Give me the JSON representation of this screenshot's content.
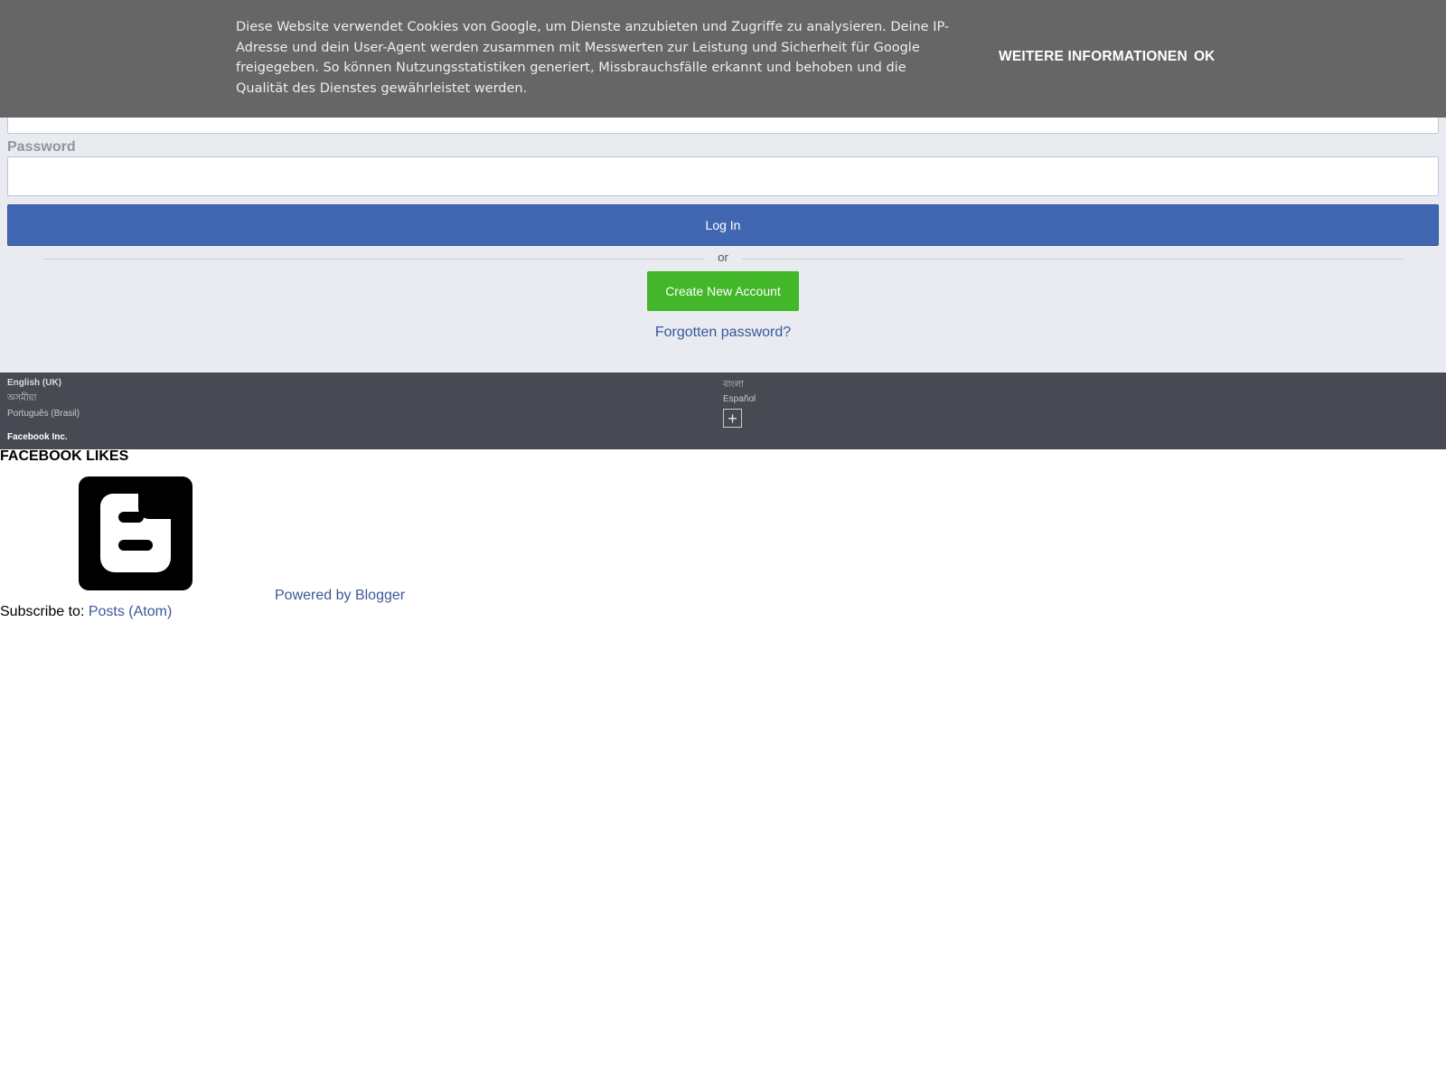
{
  "cookie_banner": {
    "message": "Diese Website verwendet Cookies von Google, um Dienste anzubieten und Zugriffe zu analysieren. Deine IP-Adresse und dein User-Agent werden zusammen mit Messwerten zur Leistung und Sicherheit für Google freigegeben. So können Nutzungsstatistiken generiert, Missbrauchsfälle erkannt und behoben und die Qualität des Dienstes gewährleistet werden.",
    "more_info_label": "WEITERE INFORMATIONEN",
    "ok_label": "OK",
    "background_color": "#666666"
  },
  "login": {
    "password_label": "Password",
    "login_button_label": "Log In",
    "or_label": "or",
    "create_account_label": "Create New Account",
    "forgot_password_label": "Forgotten password?",
    "primary_color": "#4267b2",
    "create_color": "#42b72a"
  },
  "language_footer": {
    "current_language": "English (UK)",
    "languages_left": [
      "অসমীয়া",
      "Português (Brasil)"
    ],
    "languages_right": [
      "বাংলা",
      "Español"
    ],
    "more_label": "+",
    "company": "Facebook Inc."
  },
  "blog": {
    "widget_title": "FACEBOOK LIKES",
    "powered_by_label": "Powered by Blogger",
    "subscribe_prefix": "Subscribe to: ",
    "subscribe_link": "Posts (Atom)",
    "logo_icon": "blogger-logo-icon"
  }
}
